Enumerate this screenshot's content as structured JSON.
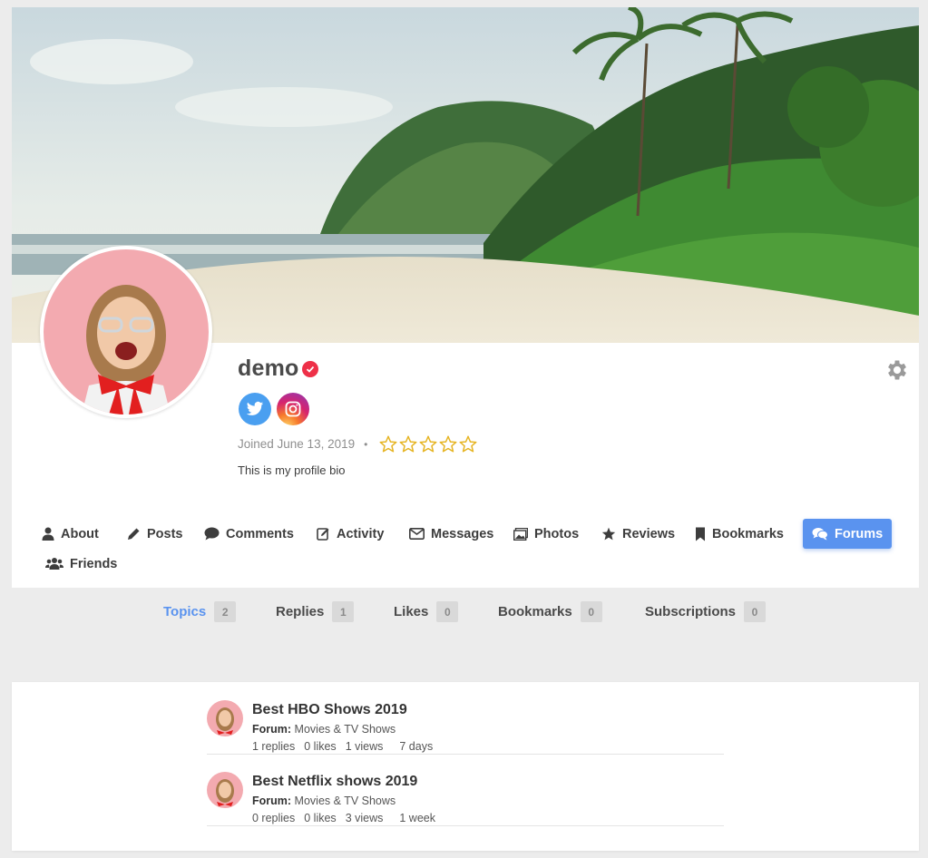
{
  "profile": {
    "username": "demo",
    "joined": "Joined June 13, 2019",
    "bio": "This is my profile bio",
    "rating": 0,
    "rating_max": 5,
    "separator": "•"
  },
  "social": [
    "twitter-icon",
    "instagram-icon"
  ],
  "colors": {
    "accent": "#5a93ef",
    "verified": "#ee3048",
    "star": "#e6b422",
    "twitter": "#4a9ff0"
  },
  "tabs": [
    {
      "label": "About",
      "icon": "user-icon"
    },
    {
      "label": "Posts",
      "icon": "pencil-icon"
    },
    {
      "label": "Comments",
      "icon": "comment-icon"
    },
    {
      "label": "Activity",
      "icon": "edit-icon"
    },
    {
      "label": "Messages",
      "icon": "envelope-icon"
    },
    {
      "label": "Photos",
      "icon": "image-icon"
    },
    {
      "label": "Reviews",
      "icon": "star-icon"
    },
    {
      "label": "Bookmarks",
      "icon": "bookmark-icon"
    },
    {
      "label": "Forums",
      "icon": "comments-icon",
      "active": true
    },
    {
      "label": "Friends",
      "icon": "users-icon"
    }
  ],
  "subnav": [
    {
      "label": "Topics",
      "count": "2",
      "active": true
    },
    {
      "label": "Replies",
      "count": "1"
    },
    {
      "label": "Likes",
      "count": "0"
    },
    {
      "label": "Bookmarks",
      "count": "0"
    },
    {
      "label": "Subscriptions",
      "count": "0"
    }
  ],
  "topics": [
    {
      "title": "Best HBO Shows 2019",
      "forum_label": "Forum:",
      "forum": "Movies & TV Shows",
      "replies": "1 replies",
      "likes": "0 likes",
      "views": "1 views",
      "ago": "7 days"
    },
    {
      "title": "Best Netflix shows 2019",
      "forum_label": "Forum:",
      "forum": "Movies & TV Shows",
      "replies": "0 replies",
      "likes": "0 likes",
      "views": "3 views",
      "ago": "1 week"
    }
  ]
}
